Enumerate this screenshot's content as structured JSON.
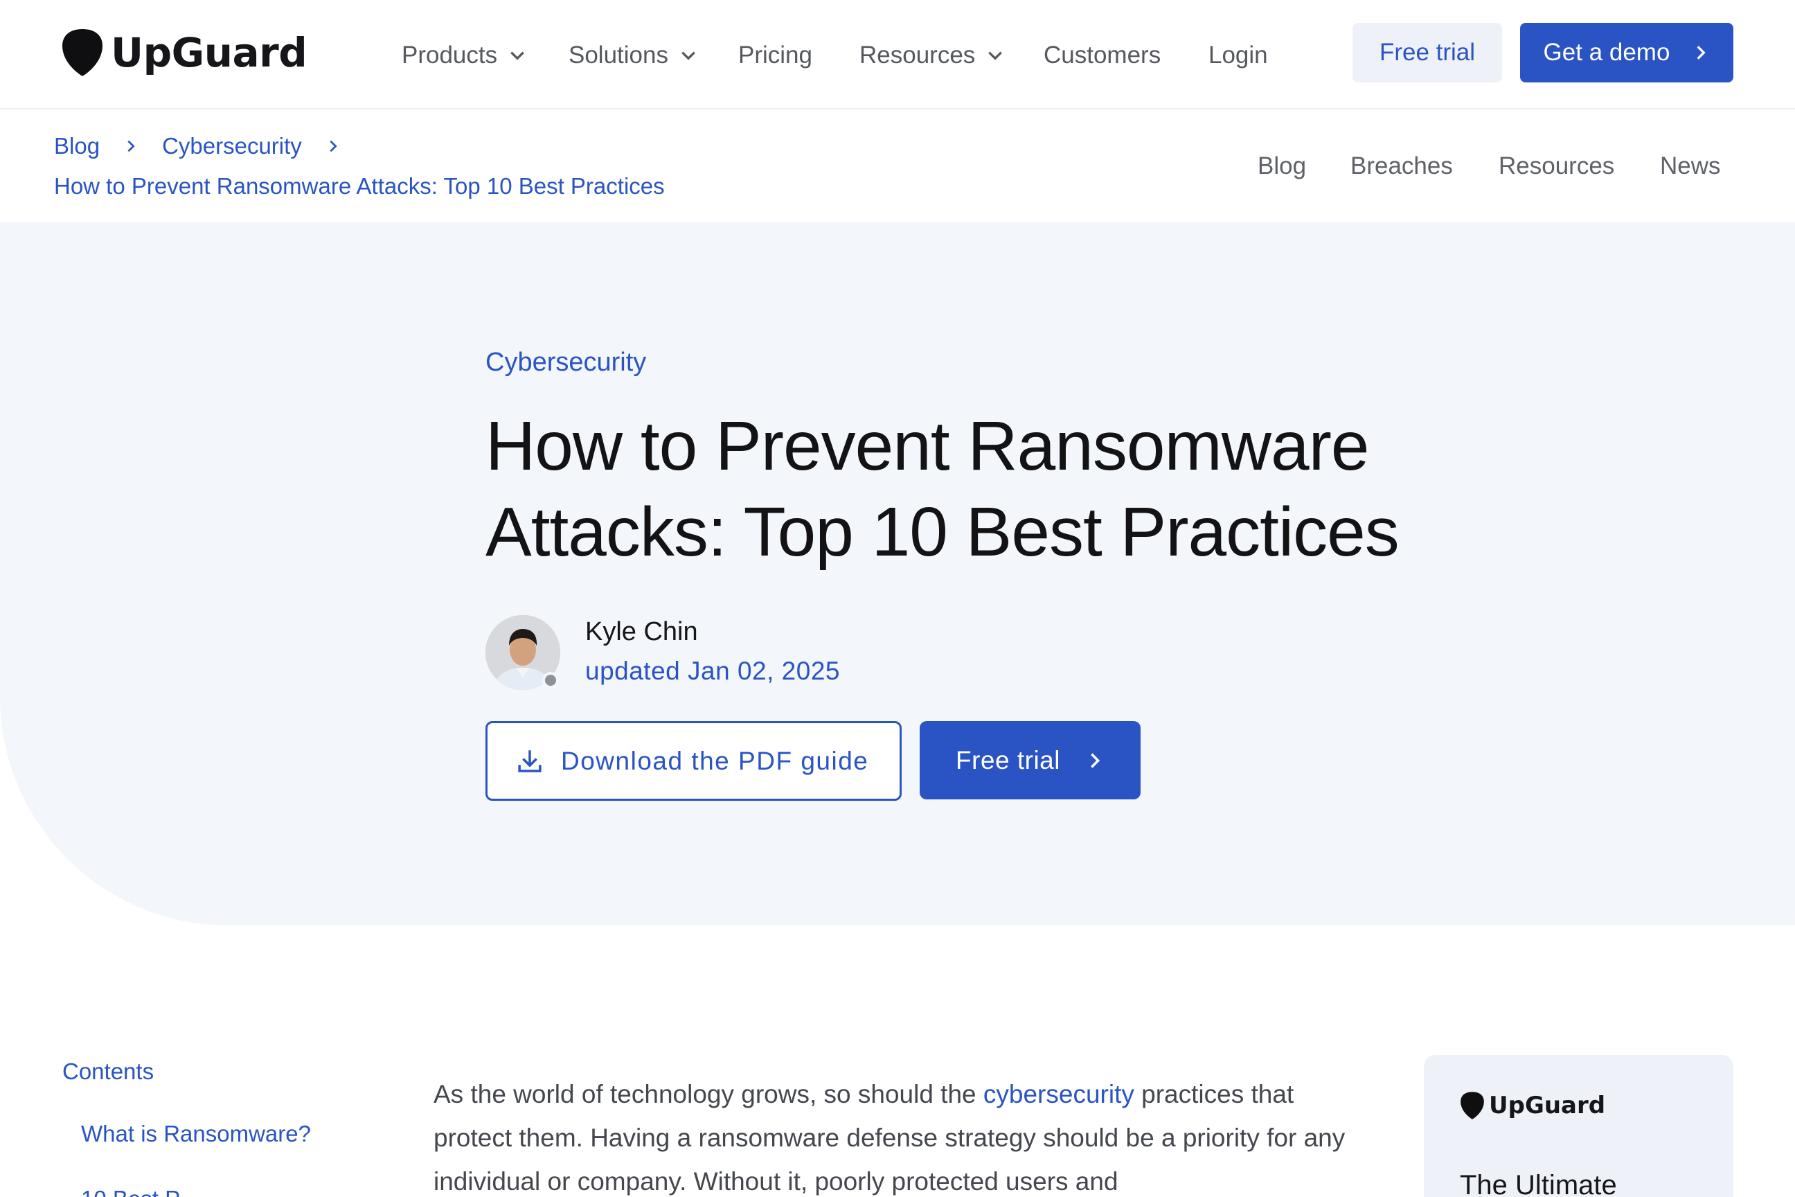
{
  "brand": {
    "name": "UpGuard"
  },
  "nav": {
    "items": [
      {
        "label": "Products",
        "dropdown": true
      },
      {
        "label": "Solutions",
        "dropdown": true
      },
      {
        "label": "Pricing",
        "dropdown": false
      },
      {
        "label": "Resources",
        "dropdown": true
      },
      {
        "label": "Customers",
        "dropdown": false
      },
      {
        "label": "Login",
        "dropdown": false
      }
    ],
    "free_trial": "Free trial",
    "get_demo": "Get a demo"
  },
  "breadcrumb": {
    "items": [
      "Blog",
      "Cybersecurity"
    ],
    "current": "How to Prevent Ransomware Attacks: Top 10 Best Practices"
  },
  "subnav": {
    "links": [
      "Blog",
      "Breaches",
      "Resources",
      "News"
    ]
  },
  "hero": {
    "category": "Cybersecurity",
    "title": "How to Prevent Ransomware Attacks: Top 10 Best Practices",
    "author": "Kyle Chin",
    "updated": "updated Jan 02, 2025",
    "download_label": "Download the PDF guide",
    "free_trial_label": "Free trial"
  },
  "toc": {
    "title": "Contents",
    "items": [
      "What is Ransomware?",
      "10 Best P..."
    ]
  },
  "article": {
    "intro_before_link": "As the world of technology grows, so should the ",
    "intro_link": "cybersecurity",
    "intro_after_link": " practices that protect them. Having a ransomware defense strategy should be a priority for any individual or company. Without it, poorly protected users and"
  },
  "side_card": {
    "brand": "UpGuard",
    "title": "The Ultimate"
  },
  "colors": {
    "accent": "#2a54c4",
    "hero_bg": "#f3f6fa",
    "text_dark": "#131316"
  }
}
